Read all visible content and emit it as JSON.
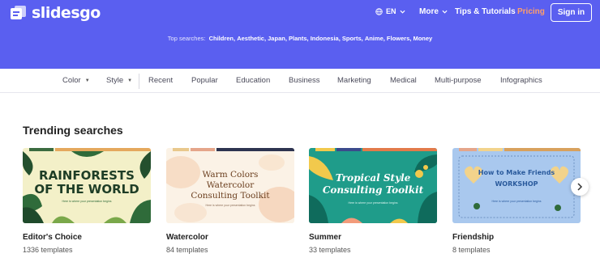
{
  "header": {
    "logo_text": "slidesgo",
    "language": "EN",
    "more_label": "More",
    "tips_label": "Tips & Tutorials",
    "pricing_label": "Pricing",
    "signin_label": "Sign in",
    "top_searches_label": "Top searches:",
    "top_searches": [
      "Children,",
      "Aesthetic,",
      "Japan,",
      "Plants,",
      "Indonesia,",
      "Sports,",
      "Anime,",
      "Flowers,",
      "Money"
    ]
  },
  "filters": {
    "color": "Color",
    "style": "Style",
    "categories": [
      "Recent",
      "Popular",
      "Education",
      "Business",
      "Marketing",
      "Medical",
      "Multi-purpose",
      "Infographics"
    ]
  },
  "trending": {
    "title": "Trending searches",
    "cards": [
      {
        "title": "Editor's Choice",
        "count": "1336 templates",
        "thumb_text": "RAINFORESTS\nOF THE WORLD",
        "thumb_sub": "Here is where your presentation begins"
      },
      {
        "title": "Watercolor",
        "count": "84 templates",
        "thumb_text": "Warm Colors\nWatercolor\nConsulting Toolkit",
        "thumb_sub": "Here is where your presentation begins"
      },
      {
        "title": "Summer",
        "count": "33 templates",
        "thumb_text": "Tropical Style\nConsulting Toolkit",
        "thumb_sub": "Here is where your presentation begins"
      },
      {
        "title": "Friendship",
        "count": "8 templates",
        "thumb_text": "How to Make Friends\nWORKSHOP",
        "thumb_sub": "Here is where your presentation begins"
      }
    ]
  },
  "colors": {
    "header_bg": "#5a5ff0",
    "pricing": "#ff9e6b",
    "card1_bg": "#f3f0c8",
    "card2_bg": "#fbf2e6",
    "card3_bg": "#1f9c8a",
    "card4_bg": "#a9c8ee"
  },
  "icons": [
    "slidesgo-logo-icon",
    "globe-icon",
    "chevron-down-icon",
    "chevron-right-icon"
  ]
}
